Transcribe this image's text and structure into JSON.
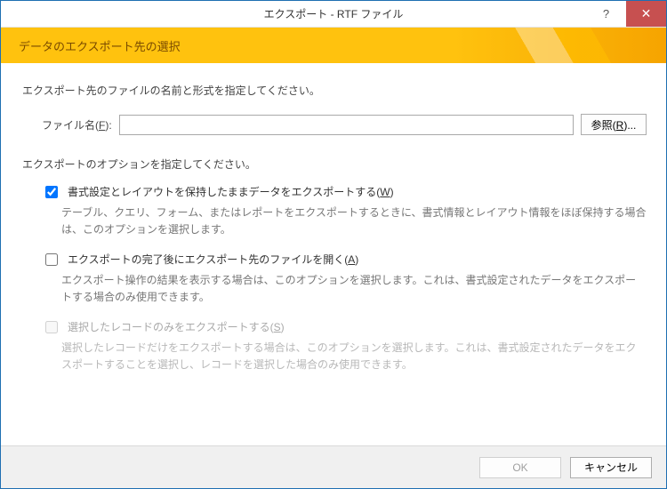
{
  "window": {
    "title": "エクスポート - RTF ファイル",
    "help_symbol": "?",
    "close_symbol": "✕"
  },
  "banner": {
    "heading": "データのエクスポート先の選択"
  },
  "content": {
    "instruction": "エクスポート先のファイルの名前と形式を指定してください。",
    "file_label_prefix": "ファイル名(",
    "file_label_key": "F",
    "file_label_suffix": "):",
    "file_value": "",
    "browse_prefix": "参照(",
    "browse_key": "R",
    "browse_suffix": ")...",
    "options_label": "エクスポートのオプションを指定してください。",
    "opt1": {
      "checked": true,
      "label_prefix": "書式設定とレイアウトを保持したままデータをエクスポートする(",
      "label_key": "W",
      "label_suffix": ")",
      "desc": "テーブル、クエリ、フォーム、またはレポートをエクスポートするときに、書式情報とレイアウト情報をほぼ保持する場合は、このオプションを選択します。"
    },
    "opt2": {
      "checked": false,
      "label_prefix": "エクスポートの完了後にエクスポート先のファイルを開く(",
      "label_key": "A",
      "label_suffix": ")",
      "desc": "エクスポート操作の結果を表示する場合は、このオプションを選択します。これは、書式設定されたデータをエクスポートする場合のみ使用できます。"
    },
    "opt3": {
      "disabled": true,
      "checked": false,
      "label_prefix": "選択したレコードのみをエクスポートする(",
      "label_key": "S",
      "label_suffix": ")",
      "desc": "選択したレコードだけをエクスポートする場合は、このオプションを選択します。これは、書式設定されたデータをエクスポートすることを選択し、レコードを選択した場合のみ使用できます。"
    }
  },
  "footer": {
    "ok": "OK",
    "cancel": "キャンセル"
  }
}
